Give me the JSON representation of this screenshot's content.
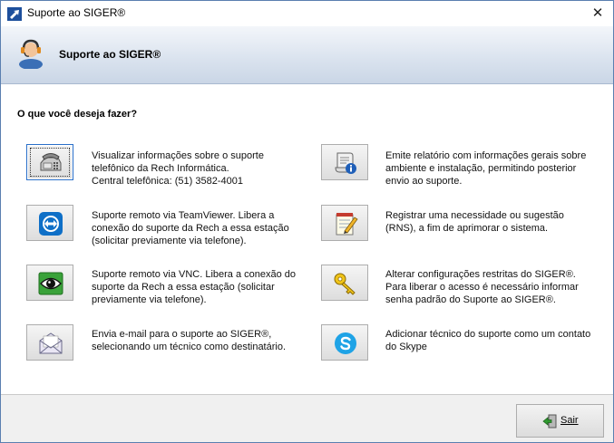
{
  "window": {
    "title": "Suporte ao SIGER®",
    "close_glyph": "✕"
  },
  "banner": {
    "title": "Suporte ao SIGER®"
  },
  "question": "O que você deseja fazer?",
  "options": [
    {
      "icon": "telephone-icon",
      "lines": [
        "Visualizar informações sobre o suporte",
        "telefônico da Rech Informática.",
        "Central telefônica: (51) 3582-4001"
      ]
    },
    {
      "icon": "teamviewer-icon",
      "lines": [
        "Suporte remoto via TeamViewer. Libera a",
        "conexão do suporte da Rech a essa estação",
        "(solicitar previamente via telefone)."
      ]
    },
    {
      "icon": "vnc-eye-icon",
      "lines": [
        "Suporte remoto via VNC. Libera a conexão do",
        "suporte da Rech a essa estação (solicitar",
        "previamente via telefone)."
      ]
    },
    {
      "icon": "email-envelope-icon",
      "lines": [
        "Envia e-mail para o suporte ao SIGER®,",
        "selecionando um técnico como destinatário."
      ]
    },
    {
      "icon": "report-scroll-icon",
      "lines": [
        "Emite relatório com informações gerais sobre",
        "ambiente e instalação, permitindo posterior",
        "envio ao suporte."
      ]
    },
    {
      "icon": "notepad-pencil-icon",
      "lines": [
        "Registrar uma necessidade ou sugestão",
        "(RNS), a fim de aprimorar o sistema."
      ]
    },
    {
      "icon": "key-icon",
      "lines": [
        "Alterar configurações restritas do SIGER®.",
        "Para liberar o acesso é necessário informar",
        "senha padrão do Suporte ao SIGER®."
      ]
    },
    {
      "icon": "skype-icon",
      "lines": [
        "Adicionar técnico do suporte como um contato",
        "do Skype"
      ]
    }
  ],
  "footer": {
    "exit_label": "Sair"
  },
  "colors": {
    "banner_top": "#f3f6fa",
    "banner_bottom": "#cad6e6",
    "focus_border": "#2a6fc9",
    "teamviewer_blue": "#0e6fc7",
    "vnc_green": "#3aa23a",
    "skype_blue": "#1fa3e6"
  }
}
